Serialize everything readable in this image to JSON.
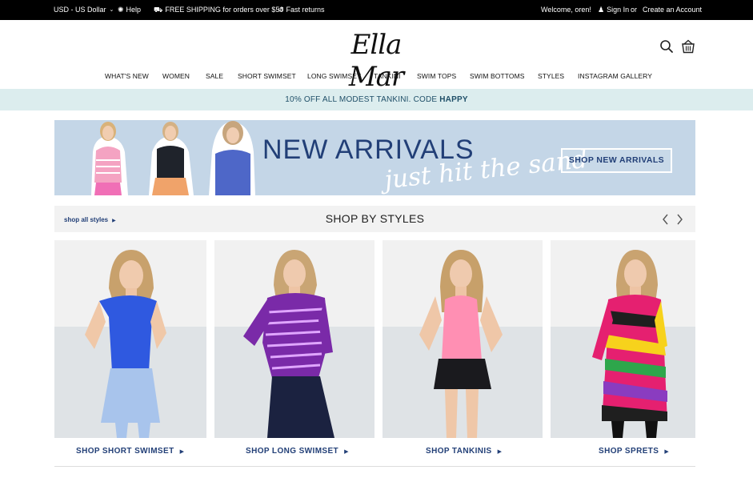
{
  "topbar": {
    "currency": "USD - US Dollar",
    "help": "Help",
    "shipping": "FREE SHIPPING for orders over $50",
    "returns": "Fast returns",
    "welcome": "Welcome, oren!",
    "sign_in": "Sign In",
    "or": "or",
    "create_account": "Create an Account"
  },
  "header": {
    "logo": "Ella Mar",
    "icons": [
      "search-icon",
      "shopping-basket-icon"
    ]
  },
  "nav": {
    "items": [
      "WHAT'S NEW",
      "WOMEN",
      "SALE",
      "SHORT SWIMSET",
      "LONG SWIMSET",
      "TANKINI",
      "SWIM TOPS",
      "SWIM BOTTOMS",
      "STYLES",
      "INSTAGRAM GALLERY"
    ]
  },
  "promo": {
    "text": "10% OFF ALL MODEST TANKINI. CODE ",
    "code": "HAPPY"
  },
  "banner": {
    "headline": "NEW ARRIVALS",
    "subline": "just hit the sand",
    "cta": "SHOP NEW ARRIVALS"
  },
  "styles_section": {
    "shop_all": "shop all styles",
    "title": "SHOP BY STYLES"
  },
  "products": [
    {
      "label": "SHOP SHORT SWIMSET"
    },
    {
      "label": "SHOP LONG SWIMSET"
    },
    {
      "label": "SHOP TANKINIS"
    },
    {
      "label": "SHOP SPRETS"
    }
  ],
  "colors": {
    "brand_navy": "#223f77",
    "promo_bg": "#dcedee",
    "banner_bg": "#c4d6e7",
    "topbar_bg": "#000000"
  }
}
